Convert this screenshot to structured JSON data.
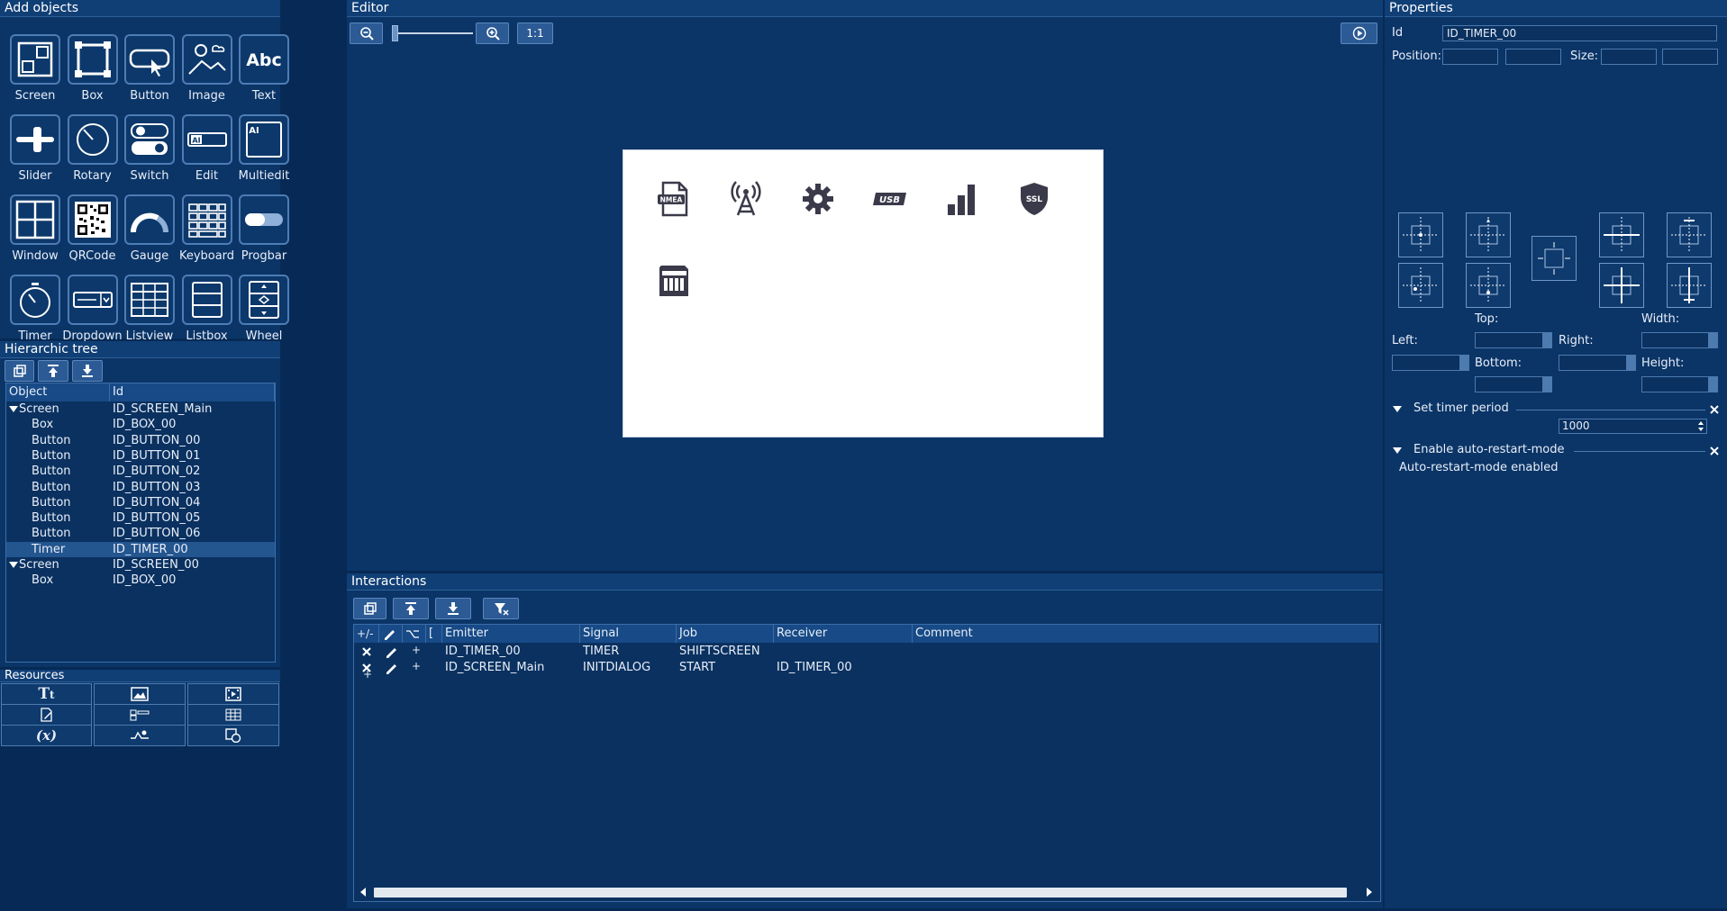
{
  "add_objects": {
    "title": "Add objects",
    "items": [
      {
        "label": "Screen",
        "icon": "screen-icon"
      },
      {
        "label": "Box",
        "icon": "box-icon"
      },
      {
        "label": "Button",
        "icon": "button-icon"
      },
      {
        "label": "Image",
        "icon": "image-icon"
      },
      {
        "label": "Text",
        "icon": "text-icon"
      },
      {
        "label": "Slider",
        "icon": "slider-icon"
      },
      {
        "label": "Rotary",
        "icon": "rotary-icon"
      },
      {
        "label": "Switch",
        "icon": "switch-icon"
      },
      {
        "label": "Edit",
        "icon": "edit-icon"
      },
      {
        "label": "Multiedit",
        "icon": "multiedit-icon"
      },
      {
        "label": "Window",
        "icon": "window-icon"
      },
      {
        "label": "QRCode",
        "icon": "qrcode-icon"
      },
      {
        "label": "Gauge",
        "icon": "gauge-icon"
      },
      {
        "label": "Keyboard",
        "icon": "keyboard-icon"
      },
      {
        "label": "Progbar",
        "icon": "progbar-icon"
      },
      {
        "label": "Timer",
        "icon": "timer-icon"
      },
      {
        "label": "Dropdown",
        "icon": "dropdown-icon"
      },
      {
        "label": "Listview",
        "icon": "listview-icon"
      },
      {
        "label": "Listbox",
        "icon": "listbox-icon"
      },
      {
        "label": "Wheel",
        "icon": "wheel-icon"
      },
      {
        "label": "",
        "icon": "movie-icon"
      },
      {
        "label": "",
        "icon": "radio-list-icon"
      },
      {
        "label": "",
        "icon": "checkbox-icon"
      }
    ],
    "text_tile": "Abc",
    "edit_tile": "AI",
    "multiedit_tile": "AI"
  },
  "hier_tree": {
    "title": "Hierarchic tree",
    "columns": [
      "Object",
      "Id"
    ],
    "rows": [
      {
        "object": "Screen",
        "id": "ID_SCREEN_Main",
        "level": 0,
        "expand": true,
        "selected": false
      },
      {
        "object": "Box",
        "id": "ID_BOX_00",
        "level": 1,
        "selected": false
      },
      {
        "object": "Button",
        "id": "ID_BUTTON_00",
        "level": 1,
        "selected": false
      },
      {
        "object": "Button",
        "id": "ID_BUTTON_01",
        "level": 1,
        "selected": false
      },
      {
        "object": "Button",
        "id": "ID_BUTTON_02",
        "level": 1,
        "selected": false
      },
      {
        "object": "Button",
        "id": "ID_BUTTON_03",
        "level": 1,
        "selected": false
      },
      {
        "object": "Button",
        "id": "ID_BUTTON_04",
        "level": 1,
        "selected": false
      },
      {
        "object": "Button",
        "id": "ID_BUTTON_05",
        "level": 1,
        "selected": false
      },
      {
        "object": "Button",
        "id": "ID_BUTTON_06",
        "level": 1,
        "selected": false
      },
      {
        "object": "Timer",
        "id": "ID_TIMER_00",
        "level": 1,
        "selected": true
      },
      {
        "object": "Screen",
        "id": "ID_SCREEN_00",
        "level": 0,
        "expand": true,
        "selected": false
      },
      {
        "object": "Box",
        "id": "ID_BOX_00",
        "level": 1,
        "selected": false
      }
    ]
  },
  "resources": {
    "title": "Resources"
  },
  "editor": {
    "title": "Editor",
    "zoom_reset": "1:1",
    "canvas_icons": [
      "nmea-icon",
      "antenna-icon",
      "gear-icon",
      "usb-icon",
      "signal-bars-icon",
      "ssl-shield-icon",
      "sd-card-icon"
    ],
    "nmea_text": "NMEA",
    "usb_text": "USB",
    "ssl_text": "SSL"
  },
  "interactions": {
    "title": "Interactions",
    "columns": {
      "pm": "+/-",
      "edit": "",
      "cond": "",
      "bracket": "[",
      "emitter": "Emitter",
      "signal": "Signal",
      "job": "Job",
      "receiver": "Receiver",
      "comment": "Comment"
    },
    "rows": [
      {
        "plus": "+",
        "emitter": "ID_TIMER_00",
        "signal": "TIMER",
        "job": "SHIFTSCREEN",
        "receiver": "",
        "comment": ""
      },
      {
        "plus": "+",
        "emitter": "ID_SCREEN_Main",
        "signal": "INITDIALOG",
        "job": "START",
        "receiver": "ID_TIMER_00",
        "comment": ""
      }
    ],
    "add_row": "+"
  },
  "properties": {
    "title": "Properties",
    "id_label": "Id",
    "id_value": "ID_TIMER_00",
    "position_label": "Position:",
    "size_label": "Size:",
    "top_label": "Top:",
    "width_label": "Width:",
    "left_label": "Left:",
    "right_label": "Right:",
    "bottom_label": "Bottom:",
    "height_label": "Height:",
    "timer_section": "Set timer period",
    "timer_value": "1000",
    "restart_section": "Enable auto-restart-mode",
    "restart_text": "Auto-restart-mode enabled"
  }
}
